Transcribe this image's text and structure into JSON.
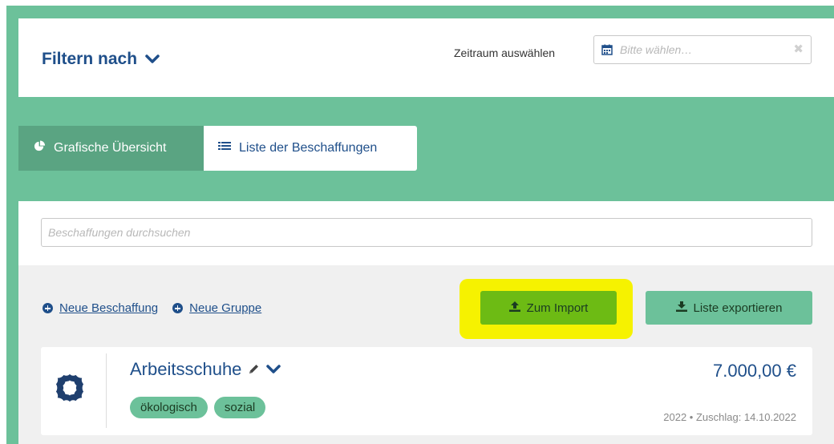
{
  "filter": {
    "title": "Filtern nach",
    "zeitraum_label": "Zeitraum auswählen",
    "date_placeholder": "Bitte wählen…",
    "clear_symbol": "✖"
  },
  "tabs": [
    {
      "label": "Grafische Übersicht",
      "icon": "pie-chart-icon",
      "active": true
    },
    {
      "label": "Liste der Beschaffungen",
      "icon": "list-icon",
      "active": false
    }
  ],
  "search": {
    "placeholder": "Beschaffungen durchsuchen"
  },
  "actions": {
    "new_procurement": "Neue Beschaffung",
    "new_group": "Neue Gruppe",
    "import_label": "Zum Import",
    "export_label": "Liste exportieren"
  },
  "procurement": {
    "title": "Arbeitsschuhe",
    "amount": "7.000,00 €",
    "tags": [
      "ökologisch",
      "sozial"
    ],
    "meta": "2022 • Zuschlag: 14.10.2022"
  },
  "colors": {
    "background_green": "#6cc19a",
    "active_tab": "#5aa482",
    "brand_blue": "#1f4f8a",
    "import_button": "#6dbb14",
    "highlight": "#f6f200"
  }
}
